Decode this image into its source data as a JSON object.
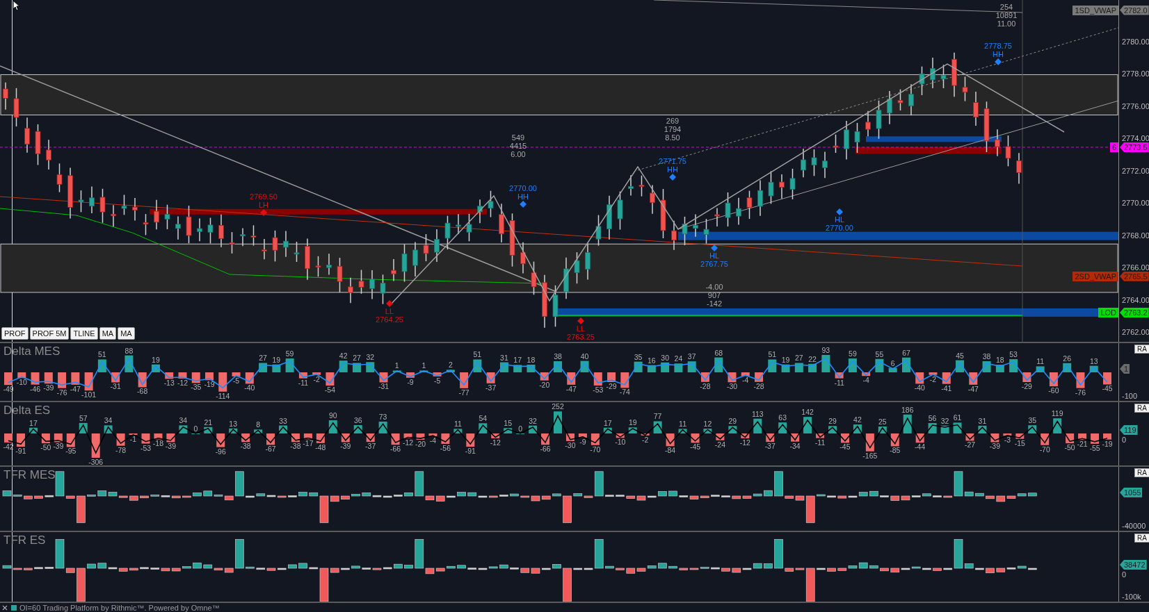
{
  "main_chart": {
    "price_axis": [
      "2780.00",
      "2778.00",
      "2776.00",
      "2774.00",
      "2772.00",
      "2770.00",
      "2768.00",
      "2766.00",
      "2764.00",
      "2762.00"
    ],
    "tags": [
      {
        "label": "1SD_VWAP",
        "value": "2782.0",
        "color": "#7a7a7a"
      },
      {
        "label": "6",
        "value": "2773.5",
        "color": "#ff00ff"
      },
      {
        "label": "2SD_VWAP",
        "value": "2765.5",
        "color": "#b52a05"
      },
      {
        "label": "LOD",
        "value": "2763.2",
        "color": "#00e000"
      }
    ],
    "stats": [
      {
        "lines": [
          "254",
          "10891",
          "11.00"
        ]
      },
      {
        "lines": [
          "269",
          "1794",
          "8.50"
        ]
      },
      {
        "lines": [
          "549",
          "4415",
          "6.00"
        ]
      },
      {
        "lines": [
          "-4.00",
          "907",
          "-142"
        ]
      }
    ],
    "pivots": [
      {
        "kind": "high",
        "label": "HH",
        "price": "2778.75",
        "color": "#1e7fff"
      },
      {
        "kind": "high",
        "label": "HH",
        "price": "2771.75",
        "color": "#1e7fff"
      },
      {
        "kind": "high",
        "label": "HH",
        "price": "2770.00",
        "color": "#1e7fff"
      },
      {
        "kind": "high",
        "label": "LH",
        "price": "2769.50",
        "color": "#e01010"
      },
      {
        "kind": "low",
        "label": "HL",
        "price": "2770.00",
        "color": "#1e7fff"
      },
      {
        "kind": "low",
        "label": "HL",
        "price": "2767.75",
        "color": "#1e7fff"
      },
      {
        "kind": "low",
        "label": "LL",
        "price": "2764.25",
        "color": "#e01010"
      },
      {
        "kind": "low",
        "label": "LL",
        "price": "2763.25",
        "color": "#e01010"
      }
    ],
    "buttons": [
      "PROF",
      "PROF 5M",
      "TLINE",
      "MA",
      "MA"
    ]
  },
  "panels": [
    {
      "kind": "delta",
      "title": "Delta MES",
      "scale_button": "RA",
      "tag": {
        "value": "1",
        "color": "#6a6a6a"
      },
      "axis_labels": [
        {
          "text": "-100",
          "kind": "bottom"
        }
      ],
      "labels": [
        "-49",
        "-10",
        "-46",
        "-39",
        "-76",
        "-47",
        "-101",
        "51",
        "-31",
        "88",
        "-68",
        "19",
        "-13",
        "-12",
        "-35",
        "-19",
        "-114",
        "-5",
        "-40",
        "27",
        "19",
        "59",
        "-11",
        "-2",
        "-54",
        "42",
        "27",
        "32",
        "-31",
        "1",
        "-9",
        "1",
        "-5",
        "2",
        "-77",
        "51",
        "-37",
        "31",
        "17",
        "18",
        "-20",
        "38",
        "-47",
        "40",
        "-53",
        "-29",
        "-74",
        "35",
        "16",
        "30",
        "24",
        "37",
        "-28",
        "68",
        "-30",
        "-4",
        "-28",
        "51",
        "19",
        "27",
        "22",
        "93",
        "-11",
        "59",
        "-4",
        "55",
        "6",
        "67",
        "-40",
        "-2",
        "-41",
        "45",
        "-47",
        "38",
        "18",
        "53",
        "-29",
        "11",
        "-60",
        "26",
        "-76",
        "13",
        "-45"
      ]
    },
    {
      "kind": "delta",
      "title": "Delta ES",
      "scale_button": "RA",
      "tag": {
        "value": "119",
        "color": "#26a69a"
      },
      "axis_labels": [
        {
          "text": "0",
          "kind": "zero"
        }
      ],
      "labels": [
        "-42",
        "-91",
        "17",
        "-50",
        "-39",
        "-95",
        "57",
        "-306",
        "34",
        "-78",
        "-1",
        "-53",
        "-18",
        "-39",
        "34",
        "0",
        "21",
        "-96",
        "13",
        "-38",
        "8",
        "-67",
        "33",
        "-38",
        "-17",
        "-48",
        "90",
        "-39",
        "36",
        "-37",
        "73",
        "-66",
        "-12",
        "-20",
        "-4",
        "-56",
        "11",
        "-91",
        "54",
        "-12",
        "15",
        "0",
        "32",
        "-66",
        "252",
        "-30",
        "-9",
        "-70",
        "17",
        "-10",
        "19",
        "-2",
        "77",
        "-84",
        "11",
        "-45",
        "12",
        "-24",
        "29",
        "-12",
        "113",
        "-37",
        "63",
        "-34",
        "142",
        "-11",
        "29",
        "-45",
        "42",
        "-165",
        "25",
        "-85",
        "186",
        "-44",
        "56",
        "32",
        "61",
        "-27",
        "31",
        "-39",
        "-3",
        "-15",
        "35",
        "-70",
        "119",
        "-50",
        "-21",
        "-55",
        "-19"
      ]
    },
    {
      "kind": "bars",
      "title": "TFR MES",
      "scale_button": "RA",
      "tag": {
        "value": "1055",
        "color": "#26a69a"
      },
      "axis_labels": [
        {
          "text": "-40000",
          "kind": "bottom"
        }
      ]
    },
    {
      "kind": "bars",
      "title": "TFR ES",
      "scale_button": "RA",
      "tag": {
        "value": "38472",
        "color": "#26a69a"
      },
      "axis_labels": [
        {
          "text": "0",
          "kind": "zero"
        },
        {
          "text": "-100k",
          "kind": "bottom"
        }
      ]
    }
  ],
  "status_bar": {
    "text": "OI=60  Trading Platform by Rithmic™. Powered by Omne™"
  }
}
